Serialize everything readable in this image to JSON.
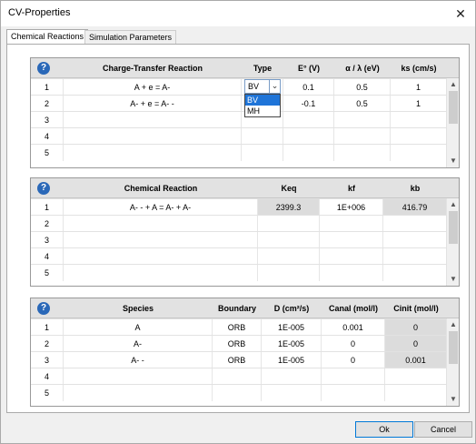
{
  "window": {
    "title": "CV-Properties",
    "close_label": "✕"
  },
  "tabs": [
    {
      "label": "Chemical Reactions"
    },
    {
      "label": "Simulation Parameters"
    }
  ],
  "charge_transfer": {
    "headers": [
      "Charge-Transfer Reaction",
      "Type",
      "E° (V)",
      "α / λ (eV)",
      "ks (cm/s)"
    ],
    "rows": [
      {
        "n": "1",
        "reaction": "A + e = A-",
        "type": "BV",
        "e0": "0.1",
        "alpha": "0.5",
        "ks": "1"
      },
      {
        "n": "2",
        "reaction": "A- + e = A- -",
        "type": "",
        "e0": "-0.1",
        "alpha": "0.5",
        "ks": "1"
      },
      {
        "n": "3",
        "reaction": "",
        "type": "",
        "e0": "",
        "alpha": "",
        "ks": ""
      },
      {
        "n": "4",
        "reaction": "",
        "type": "",
        "e0": "",
        "alpha": "",
        "ks": ""
      },
      {
        "n": "5",
        "reaction": "",
        "type": "",
        "e0": "",
        "alpha": "",
        "ks": ""
      }
    ],
    "type_options": [
      "BV",
      "MH"
    ]
  },
  "chemical": {
    "headers": [
      "Chemical Reaction",
      "Keq",
      "kf",
      "kb"
    ],
    "rows": [
      {
        "n": "1",
        "reaction": "A- - + A = A- + A-",
        "keq": "2399.3",
        "kf": "1E+006",
        "kb": "416.79"
      },
      {
        "n": "2",
        "reaction": "",
        "keq": "",
        "kf": "",
        "kb": ""
      },
      {
        "n": "3",
        "reaction": "",
        "keq": "",
        "kf": "",
        "kb": ""
      },
      {
        "n": "4",
        "reaction": "",
        "keq": "",
        "kf": "",
        "kb": ""
      },
      {
        "n": "5",
        "reaction": "",
        "keq": "",
        "kf": "",
        "kb": ""
      }
    ]
  },
  "species": {
    "headers": [
      "Species",
      "Boundary",
      "D (cm²/s)",
      "Canal (mol/l)",
      "Cinit (mol/l)"
    ],
    "rows": [
      {
        "n": "1",
        "name": "A",
        "boundary": "ORB",
        "d": "1E-005",
        "canal": "0.001",
        "cinit": "0"
      },
      {
        "n": "2",
        "name": "A-",
        "boundary": "ORB",
        "d": "1E-005",
        "canal": "0",
        "cinit": "0"
      },
      {
        "n": "3",
        "name": "A- -",
        "boundary": "ORB",
        "d": "1E-005",
        "canal": "0",
        "cinit": "0.001"
      },
      {
        "n": "4",
        "name": "",
        "boundary": "",
        "d": "",
        "canal": "",
        "cinit": ""
      },
      {
        "n": "5",
        "name": "",
        "boundary": "",
        "d": "",
        "canal": "",
        "cinit": ""
      }
    ]
  },
  "icons": {
    "help": "?",
    "up": "▲",
    "down": "▼",
    "combo": "⌄"
  },
  "buttons": {
    "ok": "Ok",
    "cancel": "Cancel"
  },
  "colors": {
    "help_icon": "#2a68b8",
    "selected_option": "#1e74d8",
    "readonly_cell": "#dcdcdc"
  }
}
